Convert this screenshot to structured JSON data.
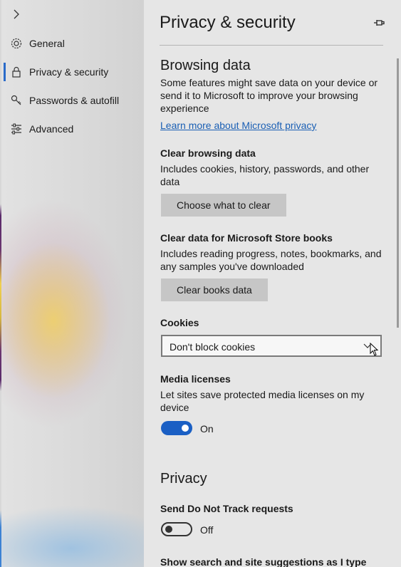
{
  "sidebar": {
    "items": [
      {
        "label": "General",
        "icon": "gear-icon",
        "active": false
      },
      {
        "label": "Privacy & security",
        "icon": "lock-icon",
        "active": true
      },
      {
        "label": "Passwords & autofill",
        "icon": "key-icon",
        "active": false
      },
      {
        "label": "Advanced",
        "icon": "sliders-icon",
        "active": false
      }
    ]
  },
  "header": {
    "title": "Privacy & security"
  },
  "browsing_data": {
    "heading": "Browsing data",
    "description": "Some features might save data on your device or send it to Microsoft to improve your browsing experience",
    "link": "Learn more about Microsoft privacy",
    "clear": {
      "heading": "Clear browsing data",
      "description": "Includes cookies, history, passwords, and other data",
      "button": "Choose what to clear"
    },
    "books": {
      "heading": "Clear data for Microsoft Store books",
      "description": "Includes reading progress, notes, bookmarks, and any samples you've downloaded",
      "button": "Clear books data"
    },
    "cookies": {
      "heading": "Cookies",
      "selected": "Don't block cookies"
    },
    "media": {
      "heading": "Media licenses",
      "description": "Let sites save protected media licenses on my device",
      "toggle_state": "On"
    }
  },
  "privacy": {
    "heading": "Privacy",
    "dnt": {
      "heading": "Send Do Not Track requests",
      "toggle_state": "Off"
    },
    "suggestions": {
      "heading": "Show search and site suggestions as I type"
    }
  },
  "colors": {
    "accent": "#1a5fc4",
    "link": "#1a5fb4",
    "button_bg": "#c6c6c6"
  }
}
